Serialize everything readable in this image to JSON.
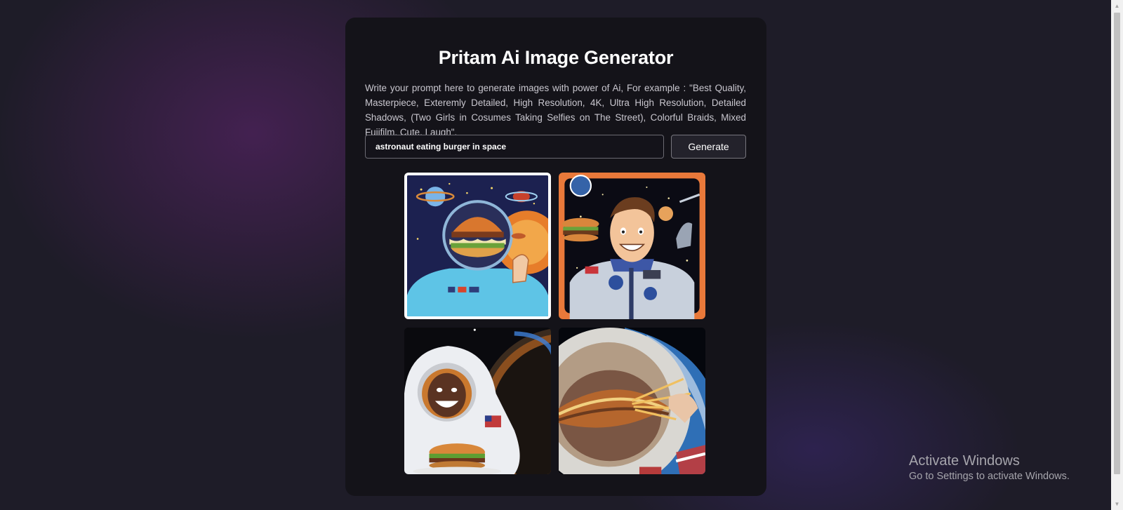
{
  "app": {
    "title": "Pritam Ai Image Generator",
    "description": "Write your prompt here to generate images with power of Ai, For example : \"Best Quality, Masterpiece, Exteremly Detailed, High Resolution, 4K, Ultra High Resolution, Detailed Shadows, (Two Girls in Cosumes Taking Selfies on The Street), Colorful Braids, Mixed Fujifilm, Cute, Laugh\"."
  },
  "form": {
    "prompt_value": "astronaut eating burger in space",
    "generate_label": "Generate"
  },
  "results": {
    "images": [
      {
        "subject": "cartoon astronaut with burger helmet holding food",
        "selected": true
      },
      {
        "subject": "smiling cartoon astronaut holding a burger"
      },
      {
        "subject": "child astronaut holding a burger in space"
      },
      {
        "subject": "astronaut eating a burger with fries above earth"
      }
    ]
  },
  "os_overlay": {
    "title": "Activate Windows",
    "subtitle": "Go to Settings to activate Windows."
  },
  "colors": {
    "background": "#1e1c28",
    "card": "#141319",
    "text": "#ffffff",
    "muted_text": "#c9c7cf"
  }
}
